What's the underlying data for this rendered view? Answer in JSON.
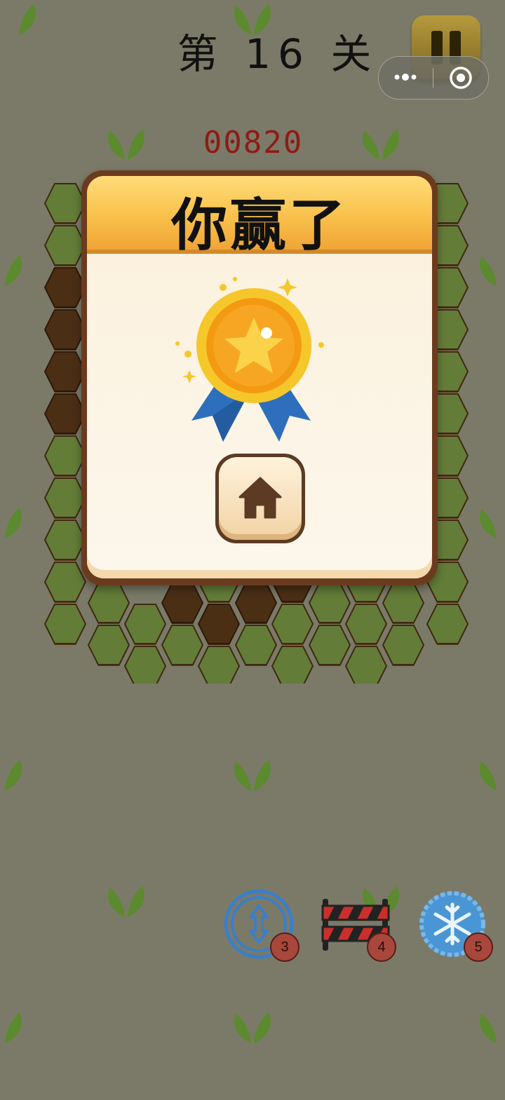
{
  "level": {
    "title": "第 16 关"
  },
  "score": {
    "value": "00820"
  },
  "dialog": {
    "title": "你赢了"
  },
  "powerups": [
    {
      "name": "swap",
      "count": "3"
    },
    {
      "name": "barrier",
      "count": "4"
    },
    {
      "name": "freeze",
      "count": "5"
    }
  ],
  "colors": {
    "background": "#7b7a68",
    "score": "#8e1b16",
    "grass": "#627f3b",
    "dirt": "#4a2f16",
    "header": "#f9c14b"
  }
}
